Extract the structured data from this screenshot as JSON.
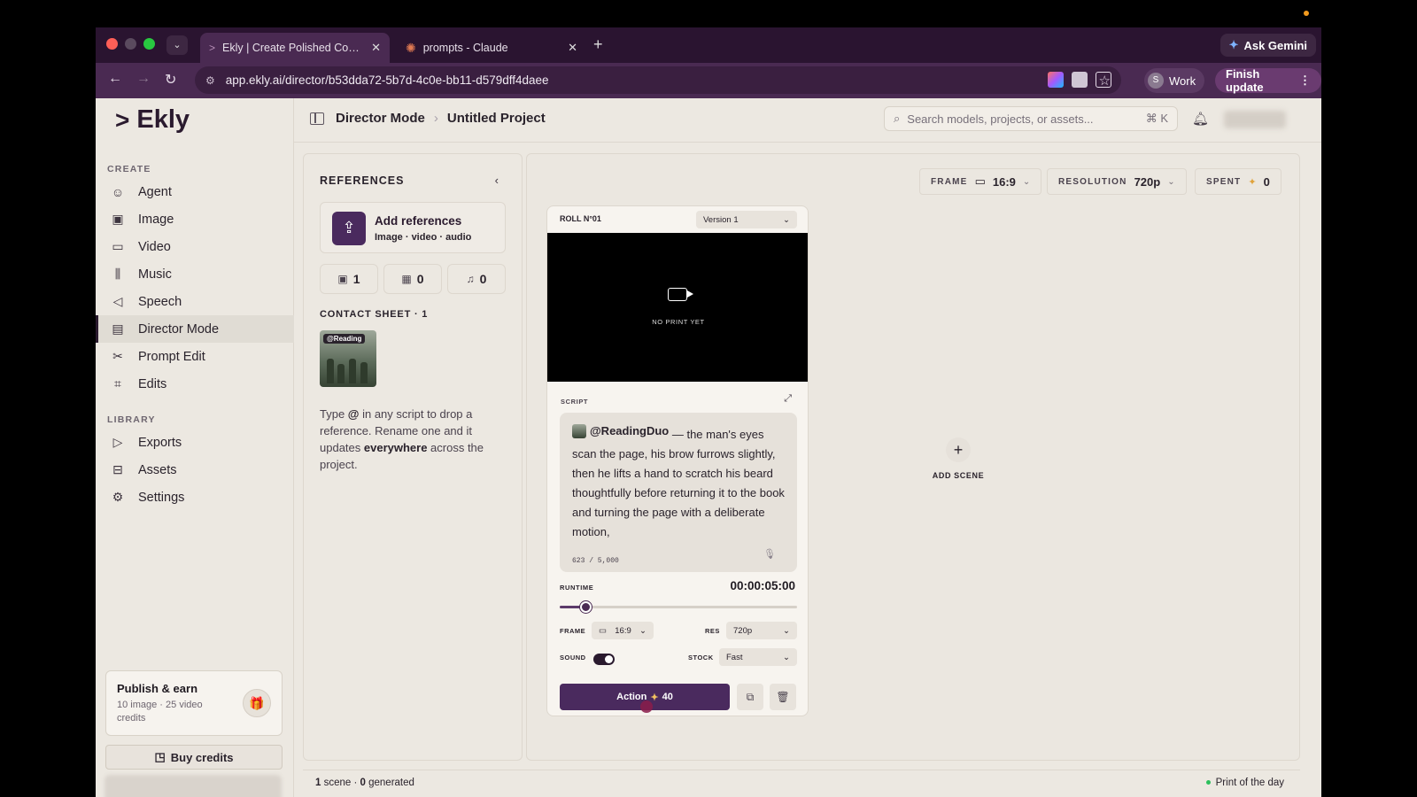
{
  "browser": {
    "tabs": [
      {
        "title": "Ekly | Create Polished Content",
        "favicon": "ekly-icon"
      },
      {
        "title": "prompts - Claude",
        "favicon": "claude-icon"
      }
    ],
    "ask_gemini": "Ask Gemini",
    "url": "app.ekly.ai/director/b53dda72-5b7d-4c0e-bb11-d579dff4daee",
    "profile_initial": "S",
    "profile_name": "Work",
    "finish_update": "Finish update"
  },
  "app": {
    "logo": "Ekly",
    "sidebar": {
      "create_label": "CREATE",
      "create_items": [
        {
          "label": "Agent",
          "icon": "robot-icon"
        },
        {
          "label": "Image",
          "icon": "image-icon"
        },
        {
          "label": "Video",
          "icon": "video-icon"
        },
        {
          "label": "Music",
          "icon": "waveform-icon"
        },
        {
          "label": "Speech",
          "icon": "speech-icon"
        },
        {
          "label": "Director Mode",
          "icon": "clapper-icon",
          "active": true
        },
        {
          "label": "Prompt Edit",
          "icon": "scissors-icon"
        },
        {
          "label": "Edits",
          "icon": "crop-icon"
        }
      ],
      "library_label": "LIBRARY",
      "library_items": [
        {
          "label": "Exports",
          "icon": "play-icon"
        },
        {
          "label": "Assets",
          "icon": "archive-icon"
        },
        {
          "label": "Settings",
          "icon": "gear-icon"
        }
      ],
      "publish": {
        "title": "Publish & earn",
        "subtitle": "10 image · 25 video credits"
      },
      "buy_credits": "Buy credits"
    },
    "topbar": {
      "breadcrumb": [
        "Director Mode",
        "Untitled Project"
      ],
      "search_placeholder": "Search models, projects, or assets...",
      "search_shortcut": "⌘ K"
    },
    "references": {
      "title": "REFERENCES",
      "add_title": "Add references",
      "add_subtitle": "Image · video · audio",
      "counts": {
        "image": "1",
        "video": "0",
        "audio": "0"
      },
      "contact_sheet": "CONTACT SHEET · 1",
      "thumb_tag": "@Reading",
      "help_pre": "Type ",
      "help_at": "@",
      "help_mid": " in any script to drop a reference. Rename one and it updates ",
      "help_bold": "everywhere",
      "help_post": " across the project."
    },
    "canvas": {
      "frame_label": "FRAME",
      "frame_value": "16:9",
      "resolution_label": "RESOLUTION",
      "resolution_value": "720p",
      "spent_label": "SPENT",
      "spent_value": "0",
      "scene": {
        "roll": "ROLL N°01",
        "version": "Version 1",
        "no_print": "NO PRINT YET",
        "script_label": "SCRIPT",
        "mention": "@ReadingDuo",
        "script_text": " — the man's eyes scan the page, his brow furrows slightly, then he lifts a hand to scratch his beard thoughtfully before returning it to the book and turning the page with a deliberate motion,",
        "char_count": "623 / 5,000",
        "runtime_label": "RUNTIME",
        "runtime_value": "00:00:05:00",
        "runtime_fraction": 0.11,
        "frame_label": "FRAME",
        "frame_value": "16:9",
        "res_label": "RES",
        "res_value": "720p",
        "sound_label": "SOUND",
        "sound_on": true,
        "stock_label": "STOCK",
        "stock_value": "Fast",
        "action_label": "Action",
        "action_cost": "40"
      },
      "add_scene": "ADD SCENE"
    },
    "status": {
      "scenes": "1",
      "scenes_text": " scene · ",
      "generated": "0",
      "generated_text": " generated",
      "print_of_day": "Print of the day"
    }
  },
  "colors": {
    "accent": "#4a2a5e",
    "chrome": "#4a2a52",
    "status_ok": "#2cbf5c"
  }
}
